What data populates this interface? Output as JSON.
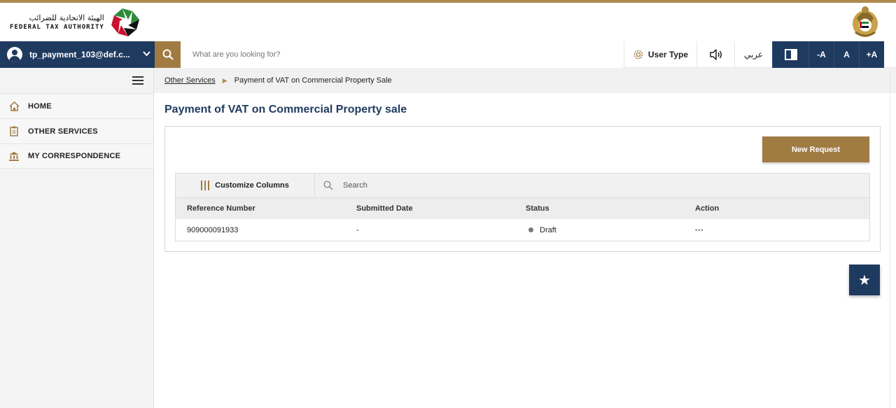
{
  "header": {
    "org_name_ar": "الهيئة الاتحادية للضرائب",
    "org_name_en": "FEDERAL TAX AUTHORITY",
    "logo_icon": "fta-logo-icon",
    "emblem_icon": "uae-emblem-icon"
  },
  "toolbar": {
    "user_email": "tp_payment_103@def.c...",
    "search_placeholder": "What are you looking for?",
    "user_type_label": "User Type",
    "language_label": "عربي",
    "font_decrease": "-A",
    "font_reset": "A",
    "font_increase": "+A"
  },
  "sidebar": {
    "items": [
      {
        "label": "HOME",
        "icon": "home-icon"
      },
      {
        "label": "OTHER SERVICES",
        "icon": "clipboard-icon"
      },
      {
        "label": "MY CORRESPONDENCE",
        "icon": "bank-icon"
      }
    ]
  },
  "breadcrumb": {
    "parent": "Other Services",
    "current": "Payment of VAT on Commercial Property Sale"
  },
  "main": {
    "title": "Payment of VAT on Commercial Property sale",
    "new_request_label": "New Request",
    "customize_label": "Customize Columns",
    "search_label": "Search",
    "columns": [
      "Reference Number",
      "Submitted Date",
      "Status",
      "Action"
    ],
    "rows": [
      {
        "reference": "909000091933",
        "submitted": "-",
        "status": "Draft",
        "action": "•••"
      }
    ]
  },
  "colors": {
    "navy": "#1f3a5f",
    "gold": "#a07c43",
    "status_draft": "#7a7a7a"
  },
  "favorite_icon": "star-icon"
}
